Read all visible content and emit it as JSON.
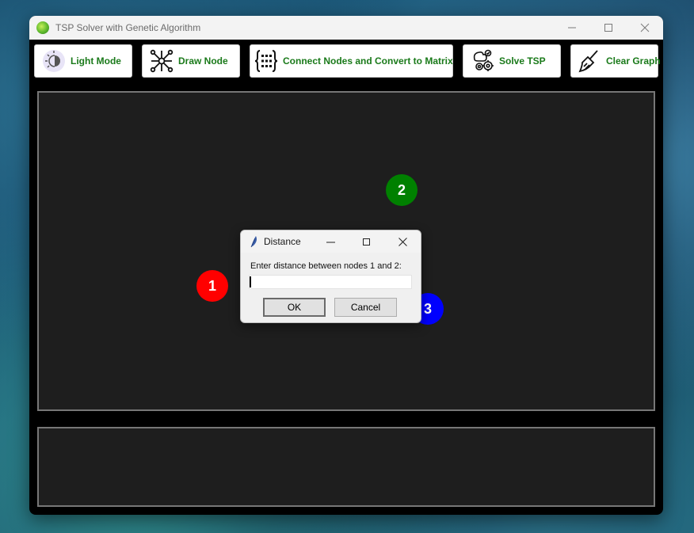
{
  "window": {
    "title": "TSP Solver with Genetic Algorithm"
  },
  "toolbar": {
    "accent_color": "#1a7a1a",
    "buttons": [
      {
        "label": "Light Mode",
        "icon": "light-bulb-icon"
      },
      {
        "label": "Draw Node",
        "icon": "network-nodes-icon"
      },
      {
        "label": "Connect Nodes and Convert to Matrix",
        "icon": "matrix-braces-icon"
      },
      {
        "label": "Solve TSP",
        "icon": "brain-gears-icon"
      },
      {
        "label": "Clear Graph",
        "icon": "broom-icon"
      }
    ]
  },
  "graph": {
    "nodes": [
      {
        "label": "1",
        "color": "#ff0000"
      },
      {
        "label": "2",
        "color": "#008000"
      },
      {
        "label": "3",
        "color": "#0000ff"
      }
    ]
  },
  "dialog": {
    "title": "Distance",
    "prompt": "Enter distance between nodes 1 and 2:",
    "input_value": "",
    "ok_label": "OK",
    "cancel_label": "Cancel"
  }
}
